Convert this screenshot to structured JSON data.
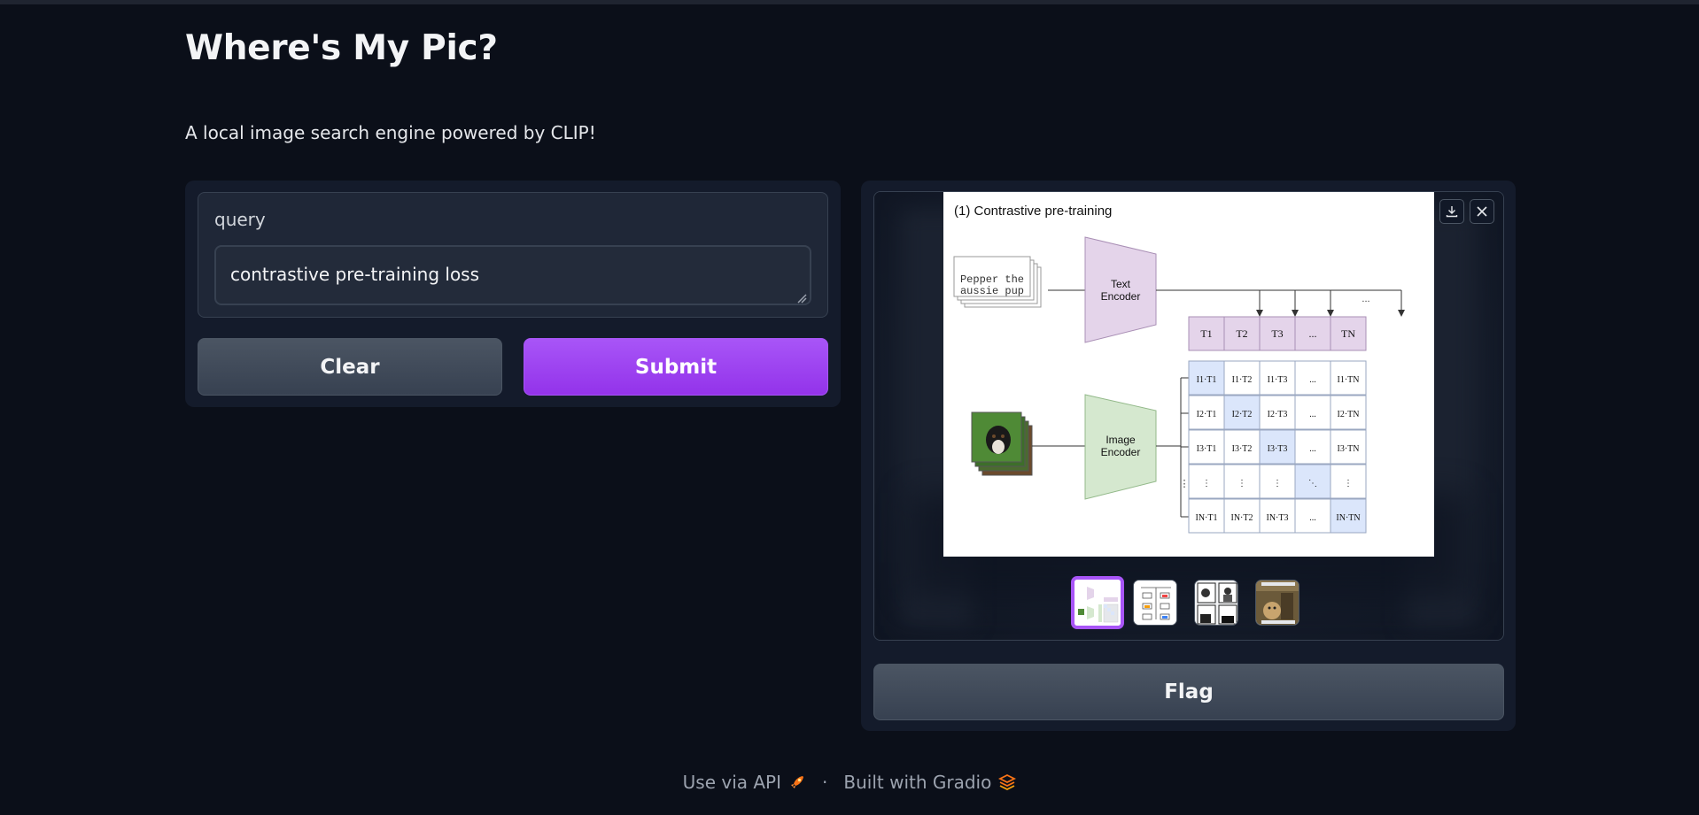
{
  "app": {
    "title": "Where's My Pic?",
    "description": "A local image search engine powered by CLIP!"
  },
  "query": {
    "label": "query",
    "value": "contrastive pre-training loss"
  },
  "buttons": {
    "clear": "Clear",
    "submit": "Submit",
    "flag": "Flag"
  },
  "gallery": {
    "selected_index": 0,
    "thumbnail_count": 4,
    "figure": {
      "heading": "(1) Contrastive pre-training",
      "text_input": [
        "Pepper the",
        "aussie pup"
      ],
      "text_encoder": [
        "Text",
        "Encoder"
      ],
      "image_encoder": [
        "Image",
        "Encoder"
      ],
      "text_tokens": [
        "T1",
        "T2",
        "T3",
        "...",
        "TN"
      ],
      "image_tokens": [
        "I1",
        "I2",
        "I3",
        "⋮",
        "IN"
      ],
      "matrix": [
        [
          "I1·T1",
          "I1·T2",
          "I1·T3",
          "...",
          "I1·TN"
        ],
        [
          "I2·T1",
          "I2·T2",
          "I2·T3",
          "...",
          "I2·TN"
        ],
        [
          "I3·T1",
          "I3·T2",
          "I3·T3",
          "...",
          "I3·TN"
        ],
        [
          "⋮",
          "⋮",
          "⋮",
          "⋱",
          "⋮"
        ],
        [
          "IN·T1",
          "IN·T2",
          "IN·T3",
          "...",
          "IN·TN"
        ]
      ]
    }
  },
  "footer": {
    "api": "Use via API",
    "separator": "·",
    "built_with": "Built with Gradio"
  },
  "colors": {
    "background": "#0b0f19",
    "accent": "#a855f7",
    "text_encoder_fill": "#e4d4ea",
    "image_encoder_fill": "#d5e8cf",
    "diagonal_fill": "#dbe6fb"
  }
}
